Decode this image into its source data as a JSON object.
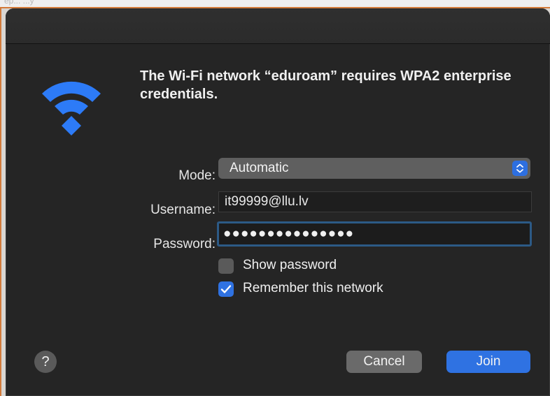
{
  "background": {
    "hint_text": "ep... ...y"
  },
  "dialog": {
    "heading": "The Wi-Fi network “eduroam” requires WPA2 enterprise credentials.",
    "mode": {
      "label": "Mode:",
      "value": "Automatic"
    },
    "username": {
      "label": "Username:",
      "value": "it99999@llu.lv"
    },
    "password": {
      "label": "Password:",
      "masked_value": "●●●●●●●●●●●●●●●"
    },
    "checkboxes": [
      {
        "label": "Show password",
        "checked": false
      },
      {
        "label": "Remember this network",
        "checked": true
      }
    ],
    "buttons": {
      "help": "?",
      "cancel": "Cancel",
      "join": "Join"
    }
  },
  "icons": {
    "wifi": "wifi-icon",
    "stepper": "chevron-up-down-icon",
    "checkmark": "checkmark-icon"
  },
  "colors": {
    "dialog_bg": "#252525",
    "accent_blue": "#2f72e2",
    "wifi_blue": "#2d7bf7",
    "focus_ring": "#2c5a86",
    "window_border": "#d37b3a"
  }
}
